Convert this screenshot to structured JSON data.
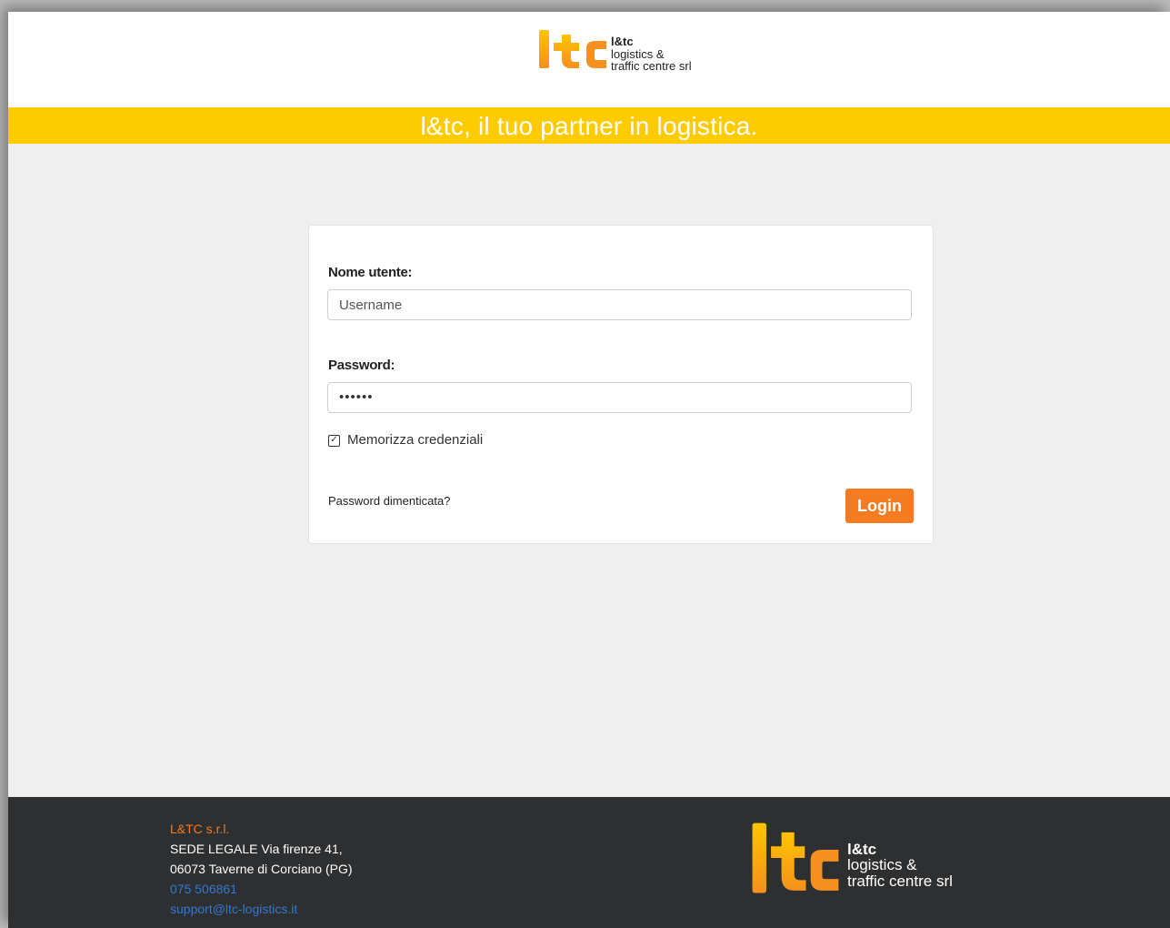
{
  "header": {
    "logo": {
      "brand": "l&tc",
      "line1": "logistics &",
      "line2": "traffic centre srl"
    },
    "tagline": "l&tc, il tuo partner in logistica."
  },
  "login": {
    "username_label": "Nome utente:",
    "username_placeholder": "Username",
    "username_value": "",
    "password_label": "Password:",
    "password_value": "••••••",
    "remember_checked": true,
    "remember_label": "Memorizza credenziali",
    "forgot_label": "Password dimenticata?",
    "login_button": "Login"
  },
  "footer": {
    "company": "L&TC s.r.l.",
    "address_line1": "SEDE LEGALE Via firenze 41,",
    "address_line2": "06073 Taverne di Corciano (PG)",
    "phone": "075 506861",
    "email": "support@ltc-logistics.it",
    "logo": {
      "brand": "l&tc",
      "line1": "logistics &",
      "line2": "traffic centre srl"
    }
  },
  "colors": {
    "banner": "#fecb00",
    "accent": "#f47b20",
    "footer_bg": "#2d2f31",
    "link": "#2f79d5"
  }
}
